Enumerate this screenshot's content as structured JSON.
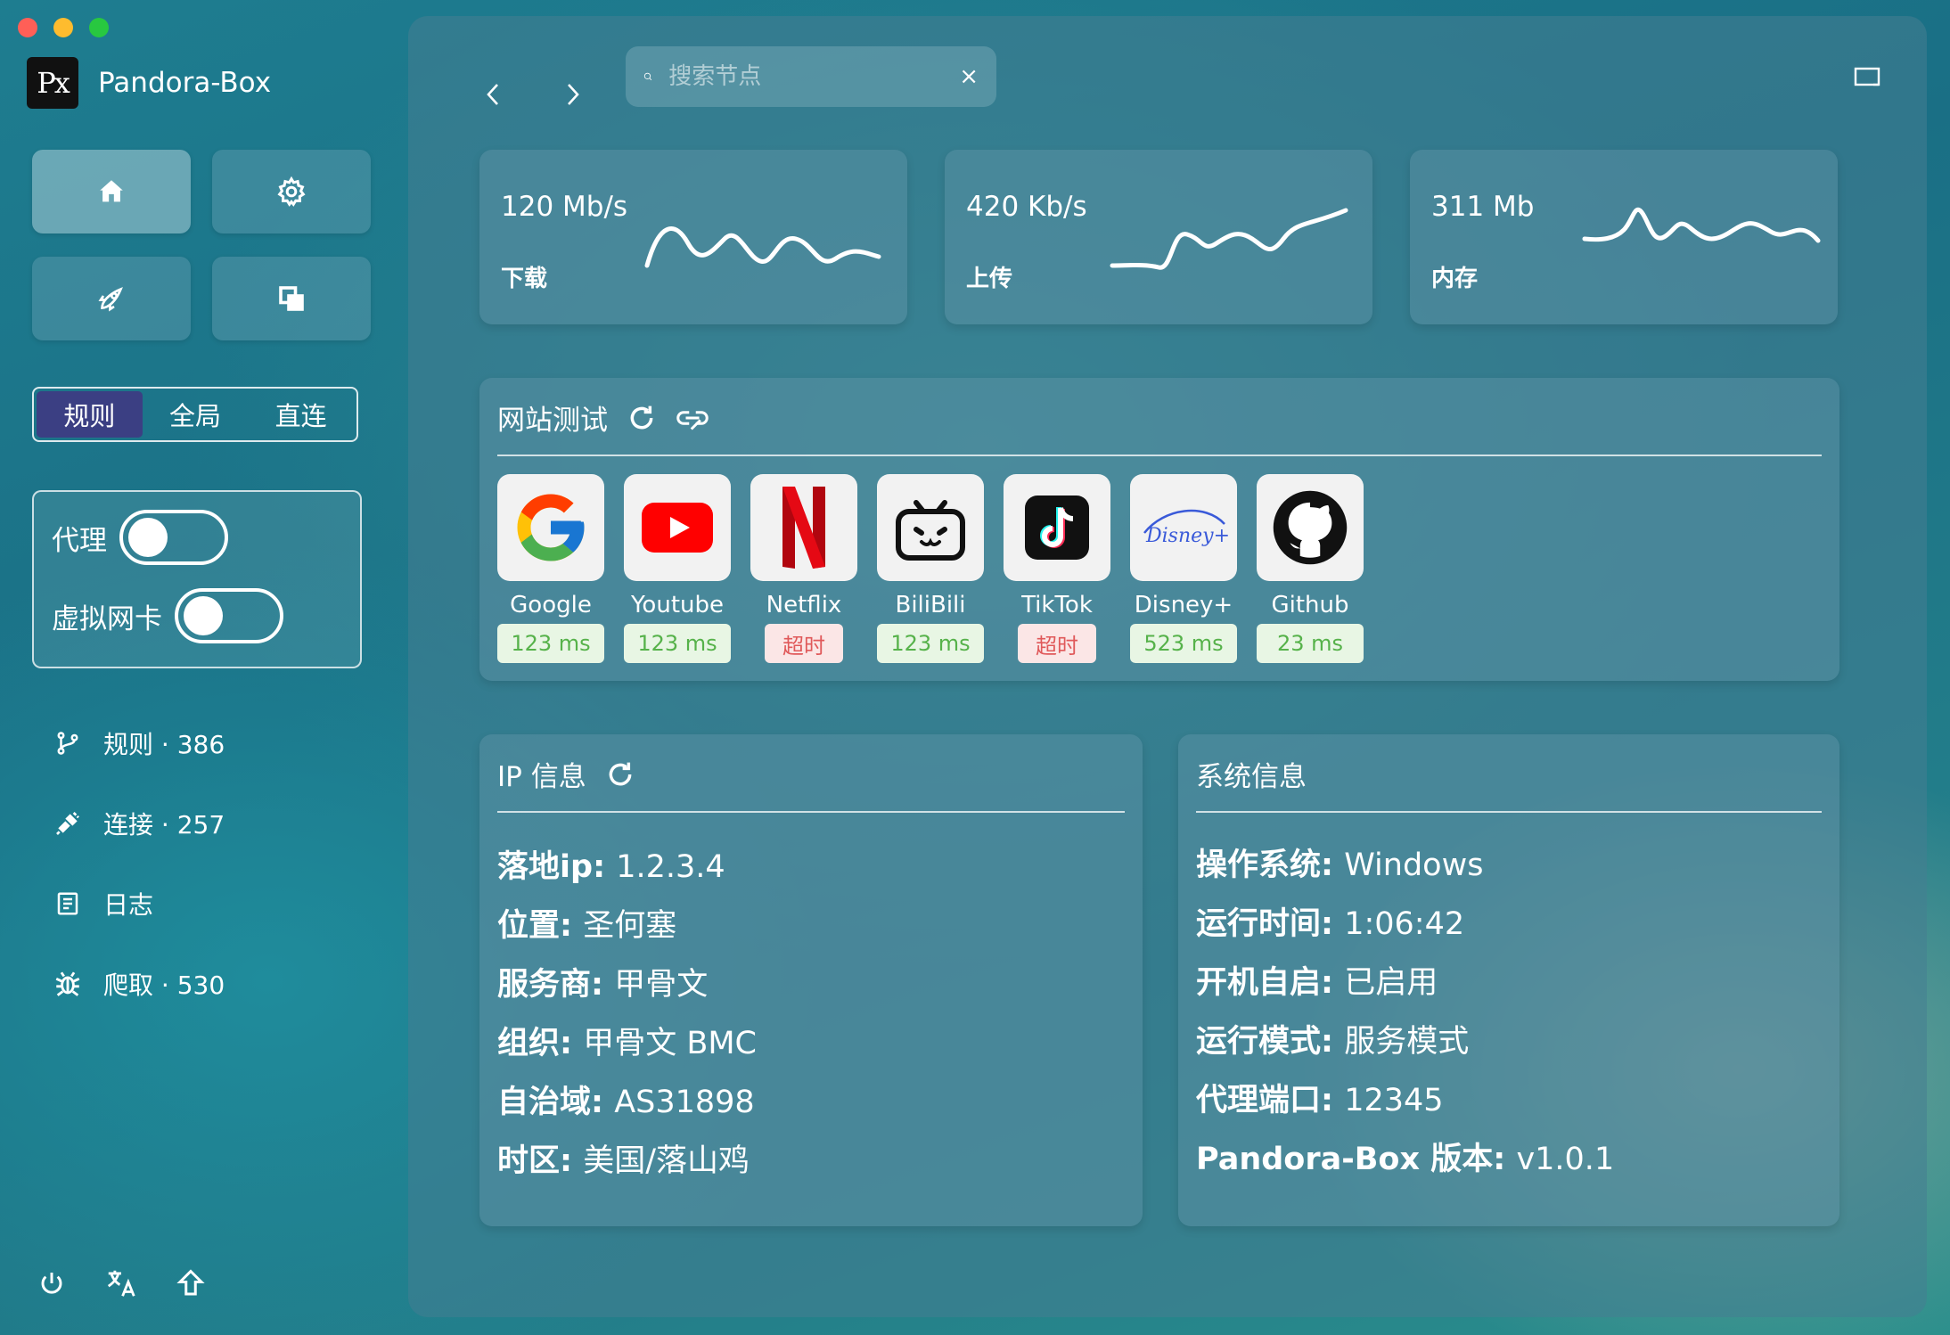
{
  "window": {
    "traffic_colors": [
      "#ff5f57",
      "#febc2e",
      "#28c840"
    ]
  },
  "brand": {
    "logo_text": "Px",
    "name": "Pandora-Box"
  },
  "mode": {
    "options": [
      "规则",
      "全局",
      "直连"
    ],
    "active": "规则"
  },
  "toggles": {
    "proxy_label": "代理",
    "tun_label": "虚拟网卡"
  },
  "sidebar": {
    "items": [
      {
        "label": "规则 · 386",
        "icon": "branch-icon"
      },
      {
        "label": "连接 · 257",
        "icon": "plug-icon"
      },
      {
        "label": "日志",
        "icon": "log-icon"
      },
      {
        "label": "爬取 · 530",
        "icon": "bug-icon"
      }
    ]
  },
  "search": {
    "placeholder": "搜索节点",
    "value": ""
  },
  "stats": [
    {
      "value": "120 Mb/s",
      "label": "下载"
    },
    {
      "value": "420 Kb/s",
      "label": "上传"
    },
    {
      "value": "311 Mb",
      "label": "内存"
    }
  ],
  "site_test": {
    "title": "网站测试",
    "sites": [
      {
        "name": "Google",
        "latency": "123 ms",
        "status": "ok"
      },
      {
        "name": "Youtube",
        "latency": "123 ms",
        "status": "ok"
      },
      {
        "name": "Netflix",
        "latency": "超时",
        "status": "timeout"
      },
      {
        "name": "BiliBili",
        "latency": "123 ms",
        "status": "ok"
      },
      {
        "name": "TikTok",
        "latency": "超时",
        "status": "timeout"
      },
      {
        "name": "Disney+",
        "latency": "523 ms",
        "status": "ok"
      },
      {
        "name": "Github",
        "latency": "23 ms",
        "status": "ok"
      }
    ]
  },
  "ip_info": {
    "title": "IP 信息",
    "rows": [
      {
        "key": "落地ip",
        "value": "1.2.3.4"
      },
      {
        "key": "位置",
        "value": "圣何塞"
      },
      {
        "key": "服务商",
        "value": "甲骨文"
      },
      {
        "key": "组织",
        "value": "甲骨文 BMC"
      },
      {
        "key": "自治域",
        "value": "AS31898"
      },
      {
        "key": "时区",
        "value": "美国/落山鸡"
      }
    ]
  },
  "system_info": {
    "title": "系统信息",
    "rows": [
      {
        "key": "操作系统",
        "value": "Windows"
      },
      {
        "key": "运行时间",
        "value": "1:06:42"
      },
      {
        "key": "开机自启",
        "value": "已启用"
      },
      {
        "key": "运行模式",
        "value": "服务模式"
      },
      {
        "key": "代理端口",
        "value": "12345"
      },
      {
        "key": "Pandora-Box 版本",
        "value": "v1.0.1"
      }
    ]
  },
  "colors": {
    "mode_active": "#3b3f83",
    "latency_ok_text": "#56b24a",
    "latency_ok_bg": "#e8f6e4",
    "latency_timeout_text": "#e0595a",
    "latency_timeout_bg": "#fbe6e6"
  }
}
